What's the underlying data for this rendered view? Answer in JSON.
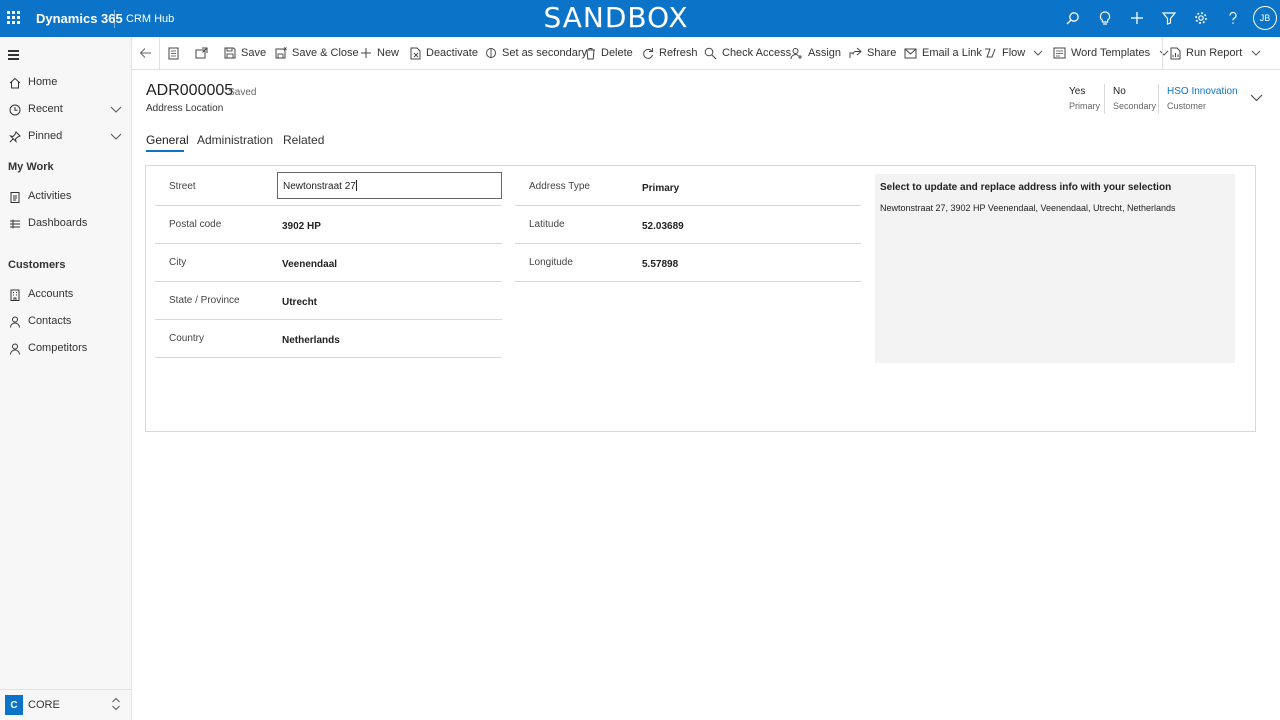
{
  "topbar": {
    "app_name": "Dynamics 365",
    "hub_name": "CRM Hub",
    "environment_banner": "SANDBOX",
    "user_initials": "JB",
    "icons": [
      "search-icon",
      "lightbulb-icon",
      "plus-icon",
      "filter-icon",
      "gear-icon",
      "help-icon"
    ]
  },
  "nav": {
    "items": [
      {
        "label": "Home",
        "icon": "home-icon"
      },
      {
        "label": "Recent",
        "icon": "clock-icon"
      },
      {
        "label": "Pinned",
        "icon": "pin-icon"
      }
    ],
    "sections": [
      {
        "title": "My Work",
        "items": [
          {
            "label": "Activities",
            "icon": "clipboard-icon"
          },
          {
            "label": "Dashboards",
            "icon": "dashboard-icon"
          }
        ]
      },
      {
        "title": "Customers",
        "items": [
          {
            "label": "Accounts",
            "icon": "building-icon"
          },
          {
            "label": "Contacts",
            "icon": "person-icon"
          },
          {
            "label": "Competitors",
            "icon": "person-icon"
          }
        ]
      }
    ],
    "area": {
      "badge": "C",
      "label": "CORE"
    }
  },
  "commands": {
    "save": "Save",
    "save_close": "Save & Close",
    "new": "New",
    "deactivate": "Deactivate",
    "set_secondary": "Set as secondary",
    "delete": "Delete",
    "refresh": "Refresh",
    "check_access": "Check Access",
    "assign": "Assign",
    "share": "Share",
    "email_link": "Email a Link",
    "flow": "Flow",
    "word_templates": "Word Templates",
    "run_report": "Run Report"
  },
  "record": {
    "title": "ADR000005",
    "status": "- Saved",
    "entity": "Address Location",
    "header_fields": [
      {
        "value": "Yes",
        "label": "Primary"
      },
      {
        "value": "No",
        "label": "Secondary"
      },
      {
        "value": "HSO Innovation",
        "label": "Customer"
      }
    ]
  },
  "tabs": [
    "General",
    "Administration",
    "Related"
  ],
  "form": {
    "street": {
      "label": "Street",
      "value": "Newtonstraat 27"
    },
    "postal_code": {
      "label": "Postal code",
      "value": "3902 HP"
    },
    "city": {
      "label": "City",
      "value": "Veenendaal"
    },
    "state": {
      "label": "State / Province",
      "value": "Utrecht"
    },
    "country": {
      "label": "Country",
      "value": "Netherlands"
    },
    "address_type": {
      "label": "Address Type",
      "value": "Primary"
    },
    "latitude": {
      "label": "Latitude",
      "value": "52.03689"
    },
    "longitude": {
      "label": "Longitude",
      "value": "5.57898"
    }
  },
  "suggestions": {
    "title": "Select to update and replace address info with your selection",
    "items": [
      "Newtonstraat 27, 3902 HP Veenendaal, Veenendaal, Utrecht, Netherlands"
    ]
  },
  "colors": {
    "accent": "#0c74c8",
    "nav_bg": "#f7f7f7",
    "suggest_bg": "#f3f3f3"
  }
}
